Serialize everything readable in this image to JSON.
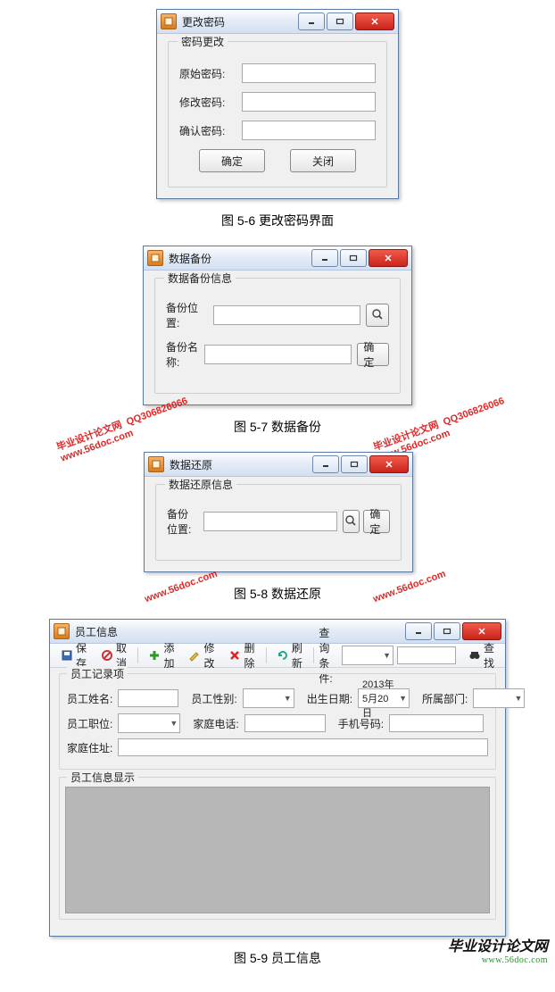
{
  "captions": {
    "fig56": "图 5-6 更改密码界面",
    "fig57": "图 5-7 数据备份",
    "fig58": "图 5-8 数据还原",
    "fig59": "图 5-9 员工信息"
  },
  "win_pwd": {
    "title": "更改密码",
    "group": "密码更改",
    "labels": {
      "orig": "原始密码:",
      "new": "修改密码:",
      "confirm": "确认密码:"
    },
    "buttons": {
      "ok": "确定",
      "close": "关闭"
    }
  },
  "win_backup": {
    "title": "数据备份",
    "group": "数据备份信息",
    "labels": {
      "path": "备份位置:",
      "name": "备份名称:"
    },
    "buttons": {
      "ok": "确定"
    }
  },
  "win_restore": {
    "title": "数据还原",
    "group": "数据还原信息",
    "labels": {
      "path": "备份位置:"
    },
    "buttons": {
      "ok": "确定"
    }
  },
  "win_emp": {
    "title": "员工信息",
    "toolbar": {
      "save": "保存",
      "cancel": "取消",
      "add": "添加",
      "edit": "修改",
      "delete": "删除",
      "refresh": "刷新",
      "cond_label": "查询条件:",
      "find": "查找"
    },
    "group1": "员工记录项",
    "group2": "员工信息显示",
    "labels": {
      "name": "员工姓名:",
      "gender": "员工性别:",
      "birth": "出生日期:",
      "dept": "所属部门:",
      "title": "员工职位:",
      "home_phone": "家庭电话:",
      "mobile": "手机号码:",
      "address": "家庭住址:"
    },
    "birth_value": "2013年 5月20日"
  },
  "watermarks": {
    "text1": "毕业设计论文网",
    "text2": "www.56doc.com",
    "text3": "QQ306826066"
  },
  "footer": {
    "line1": "毕业设计论文网",
    "line2": "www.56doc.com"
  }
}
